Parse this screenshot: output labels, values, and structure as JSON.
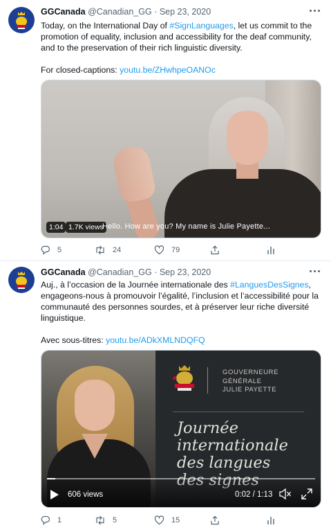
{
  "tweets": [
    {
      "name": "GGCanada",
      "handle": "@Canadian_GG",
      "dot": "·",
      "date": "Sep 23, 2020",
      "text_before_tag": "Today, on the International Day of ",
      "tag": "#SignLanguages",
      "text_after_tag": ", let us commit to the promotion of equality, inclusion and accessibility for the deaf community, and to the preservation of their rich linguistic diversity.",
      "link_label": "For closed-captions: ",
      "link": "youtu.be/ZHwhpeOANOc",
      "video": {
        "duration": "1:04",
        "views": "1.7K views",
        "caption": "Hello. How are you? My name is Julie Payette..."
      },
      "stats": {
        "replies": "5",
        "retweets": "24",
        "likes": "79"
      }
    },
    {
      "name": "GGCanada",
      "handle": "@Canadian_GG",
      "dot": "·",
      "date": "Sep 23, 2020",
      "text_before_tag": "Auj., à l’occasion de la Journée internationale des ",
      "tag": "#LanguesDesSignes",
      "text_after_tag": ", engageons-nous à promouvoir l’égalité, l’inclusion et l’accessibilité pour la communauté des personnes sourdes, et à préserver leur riche diversité linguistique.",
      "link_label": "Avec sous-titres: ",
      "link": "youtu.be/ADkXMLNDQFQ",
      "video": {
        "views": "606 views",
        "time": "0:02 / 1:13",
        "progress": 0.03,
        "org_line1": "GOUVERNEURE",
        "org_line2": "GÉNÉRALE",
        "org_line3": "JULIE PAYETTE",
        "title_line1": "Journée",
        "title_line2": "internationale",
        "title_line3": "des langues",
        "title_line4": "des signes"
      },
      "stats": {
        "replies": "1",
        "retweets": "5",
        "likes": "15"
      }
    }
  ],
  "colors": {
    "link": "#1d9bf0",
    "secondary": "#536471",
    "avatar_bg": "#1c3f94"
  }
}
